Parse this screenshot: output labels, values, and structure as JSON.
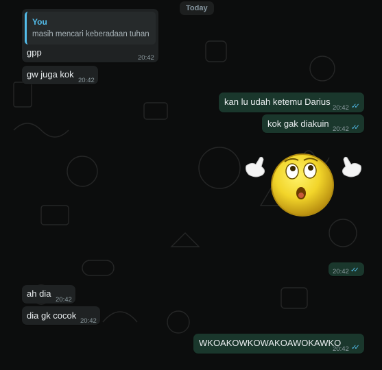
{
  "date_divider": "Today",
  "messages": [
    {
      "reply_author": "You",
      "reply_text": "masih mencari keberadaan tuhan",
      "text": "gpp",
      "time": "20:42"
    },
    {
      "text": "gw juga kok",
      "time": "20:42"
    },
    {
      "text": "kan lu udah ketemu Darius",
      "time": "20:42"
    },
    {
      "text": "kok gak diakuin",
      "time": "20:42"
    },
    {
      "sticker": "surprised-emoji-shrug",
      "time": "20:42"
    },
    {
      "text": "ah dia",
      "time": "20:42"
    },
    {
      "text": "dia gk cocok",
      "time": "20:42"
    },
    {
      "text": "WKOAKOWKOWAKOAWOKAWKO",
      "time": "20:42"
    }
  ],
  "colors": {
    "background": "#0c0d0d",
    "incoming_bubble": "#1f2223",
    "outgoing_bubble": "#1a372c",
    "read_ticks": "#53bdeb",
    "quote_accent": "#53bdeb"
  }
}
